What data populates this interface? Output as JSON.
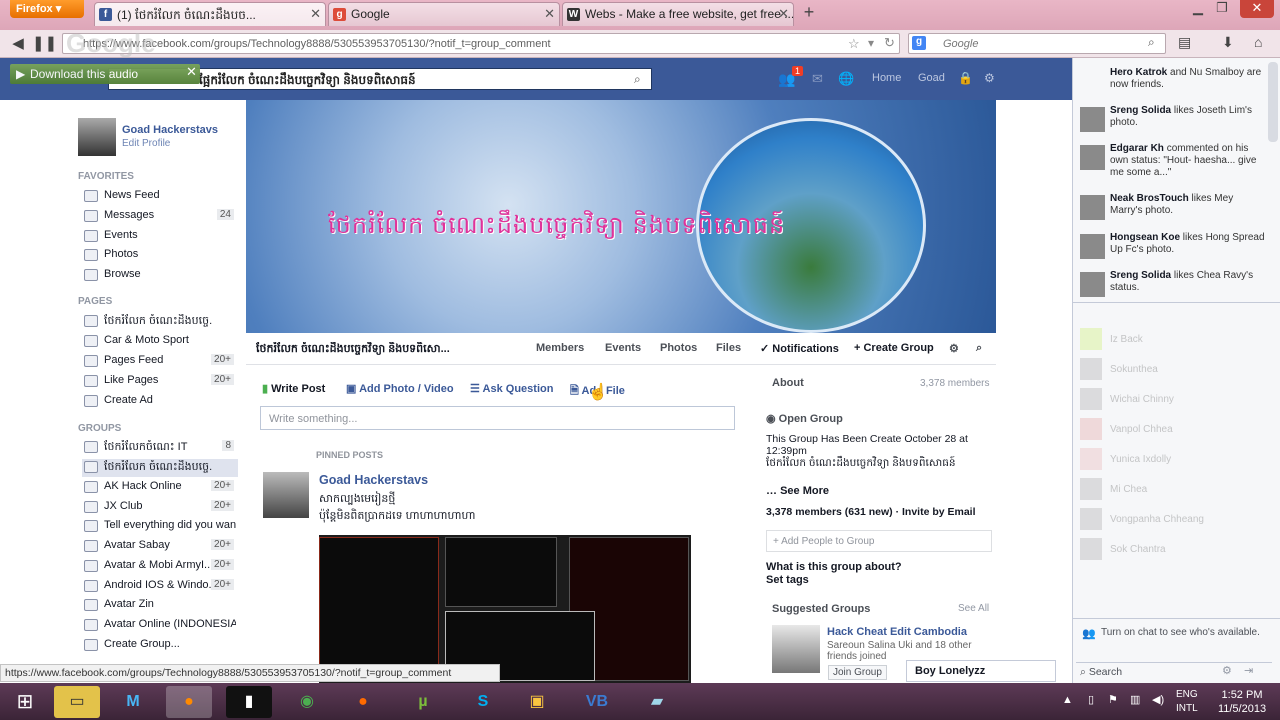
{
  "browser": {
    "menu_label": "Firefox",
    "tabs": [
      {
        "label": "(1) ថែករំលែក ចំណេះដឹងបច..."
      },
      {
        "label": "Google"
      },
      {
        "label": "Webs - Make a free website, get free ..."
      }
    ],
    "url": "https://www.facebook.com/groups/Technology8888/530553953705130/?notif_t=group_comment",
    "search_placeholder": "Google",
    "google_watermark": "Google",
    "download_audio": "Download this audio",
    "status_url": "https://www.facebook.com/groups/Technology8888/530553953705130/?notif_t=group_comment"
  },
  "fb": {
    "search_text": "ផ្អែករំលែក ចំណេះដឹងបច្ចេកវិទ្យា និងបទពិសោធន៍",
    "notif_count": "1",
    "top_nav": [
      "Home",
      "Goad"
    ],
    "profile": {
      "name": "Goad Hackerstavs",
      "edit": "Edit Profile"
    },
    "favorites_title": "FAVORITES",
    "favorites": [
      {
        "label": "News Feed",
        "count": ""
      },
      {
        "label": "Messages",
        "count": "24"
      },
      {
        "label": "Events",
        "count": ""
      },
      {
        "label": "Photos",
        "count": ""
      },
      {
        "label": "Browse",
        "count": ""
      }
    ],
    "pages_title": "PAGES",
    "pages": [
      {
        "label": "ថែករំលែក ចំណេះដឹងបច្ចេ...",
        "count": ""
      },
      {
        "label": "Car & Moto Sport",
        "count": ""
      },
      {
        "label": "Pages Feed",
        "count": "20+"
      },
      {
        "label": "Like Pages",
        "count": "20+"
      },
      {
        "label": "Create Ad",
        "count": ""
      }
    ],
    "groups_title": "GROUPS",
    "groups": [
      {
        "label": "ថែករំលែកចំណេះ IT",
        "count": "8"
      },
      {
        "label": "ថែករំលែក ចំណេះដឹងបច្ចេ...",
        "count": ""
      },
      {
        "label": "AK Hack Online",
        "count": "20+"
      },
      {
        "label": "JX Club",
        "count": "20+"
      },
      {
        "label": "Tell everything did you wan...",
        "count": ""
      },
      {
        "label": "Avatar Sabay",
        "count": "20+"
      },
      {
        "label": "Avatar & Mobi ArmyI...",
        "count": "20+"
      },
      {
        "label": "Android IOS & Windo...",
        "count": "20+"
      },
      {
        "label": "Avatar Zin",
        "count": ""
      },
      {
        "label": "Avatar Online (INDONESIA)",
        "count": ""
      },
      {
        "label": "Create Group...",
        "count": ""
      }
    ],
    "cover_title": "ថែករំលែក ចំណេះដឹងបច្ចេកវិទ្យា និងបទពិសោធន៍",
    "group_name": "ថែករំលែក ចំណេះដឹងបច្ចេកវិទ្យា និងបទពិសោ...",
    "group_nav": [
      "Members",
      "Events",
      "Photos",
      "Files"
    ],
    "notifications": "Notifications",
    "create_group": "+ Create Group",
    "composer": [
      "Write Post",
      "Add Photo / Video",
      "Ask Question",
      "Add File"
    ],
    "write_placeholder": "Write something...",
    "pinned": "PINNED POSTS",
    "post": {
      "author": "Goad Hackerstavs",
      "line1": "សាកល្បងមេរៀនថ្មី",
      "line2": "ប៉ុន្តែមិនពិតប្រាកដទេ ហាហាហាហាហា"
    },
    "about": {
      "title": "About",
      "members_short": "3,378 members",
      "open_group": "Open Group",
      "desc1": "This Group Has Been Create October 28 at",
      "desc2": "12:39pm",
      "desc3": "ថែករំលែក ចំណេះដឹងបច្ចេកវិទ្យា និងបទពិសោធន៍",
      "see_more": "See More",
      "members": "3,378 members (631 new) · Invite by Email",
      "add_people": "+ Add People to Group",
      "what": "What is this group about?",
      "tags": "Set tags",
      "suggested": "Suggested Groups",
      "see_all": "See All",
      "sugg_name": "Hack Cheat Edit Cambodia",
      "sugg_desc": "Sareoun Salina Uki and 18 other friends joined",
      "join": "Join Group"
    },
    "ticker": [
      {
        "name": "Hero Katrok",
        "text": "and Nu Smalboy are now friends."
      },
      {
        "name": "Sreng Solida",
        "text": "likes Joseth Lim's photo."
      },
      {
        "name": "Edgarar Kh",
        "text": "commented on his own status: \"Hout- haesha... give me some a...\""
      },
      {
        "name": "Neak BrosTouch",
        "text": "likes Mey Marry's photo."
      },
      {
        "name": "Hongsean Koe",
        "text": "likes Hong Spread Up Fc's photo."
      },
      {
        "name": "Sreng Solida",
        "text": "likes Chea Ravy's status."
      }
    ],
    "chat_names": [
      "Iz Back",
      "Sokunthea",
      "Wichai Chinny",
      "Vanpol Chhea",
      "Yunica Ixdolly",
      "Mi Chea",
      "Vongpanha Chheang",
      "Sok Chantra"
    ],
    "chat_off": "Turn on chat to see who's available.",
    "chat_search": "Search",
    "boy": "Boy Lonelyzz"
  },
  "taskbar": {
    "lang1": "ENG",
    "lang2": "INTL",
    "time": "1:52 PM",
    "date": "11/5/2013"
  }
}
